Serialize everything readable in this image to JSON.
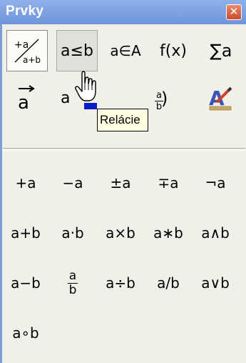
{
  "window": {
    "title": "Prvky",
    "close_glyph": "✕"
  },
  "categories": [
    {
      "key": "unary-binary",
      "top": "+a",
      "bottom": "a+b",
      "state": "selected"
    },
    {
      "key": "relations",
      "label": "a≤b",
      "state": "hover"
    },
    {
      "key": "set-operations",
      "label": "a∈A"
    },
    {
      "key": "functions",
      "label": "f(x)"
    },
    {
      "key": "operators",
      "label": "∑a"
    },
    {
      "key": "attributes",
      "label": "a⃗",
      "display": "→ a"
    },
    {
      "key": "others",
      "label": "a"
    },
    {
      "key": "brackets",
      "label": "(a/b)"
    },
    {
      "key": "formats",
      "icon": "format-letter-icon"
    }
  ],
  "tooltip": "Relácie",
  "symbols": [
    [
      "+a",
      "−a",
      "±a",
      "∓a",
      "¬a"
    ],
    [
      "a+b",
      "a·b",
      "a×b",
      "a∗b",
      "a∧b"
    ],
    [
      "a−b",
      "frac",
      "a÷b",
      "a/b",
      "a∨b"
    ],
    [
      "a∘b"
    ]
  ],
  "fraction": {
    "num": "a",
    "den": "b"
  },
  "colors": {
    "title_bar": "#7a9fe0",
    "panel": "#f1f0e8",
    "tooltip_bg": "#ffffe1",
    "close_button": "#d9603e"
  }
}
